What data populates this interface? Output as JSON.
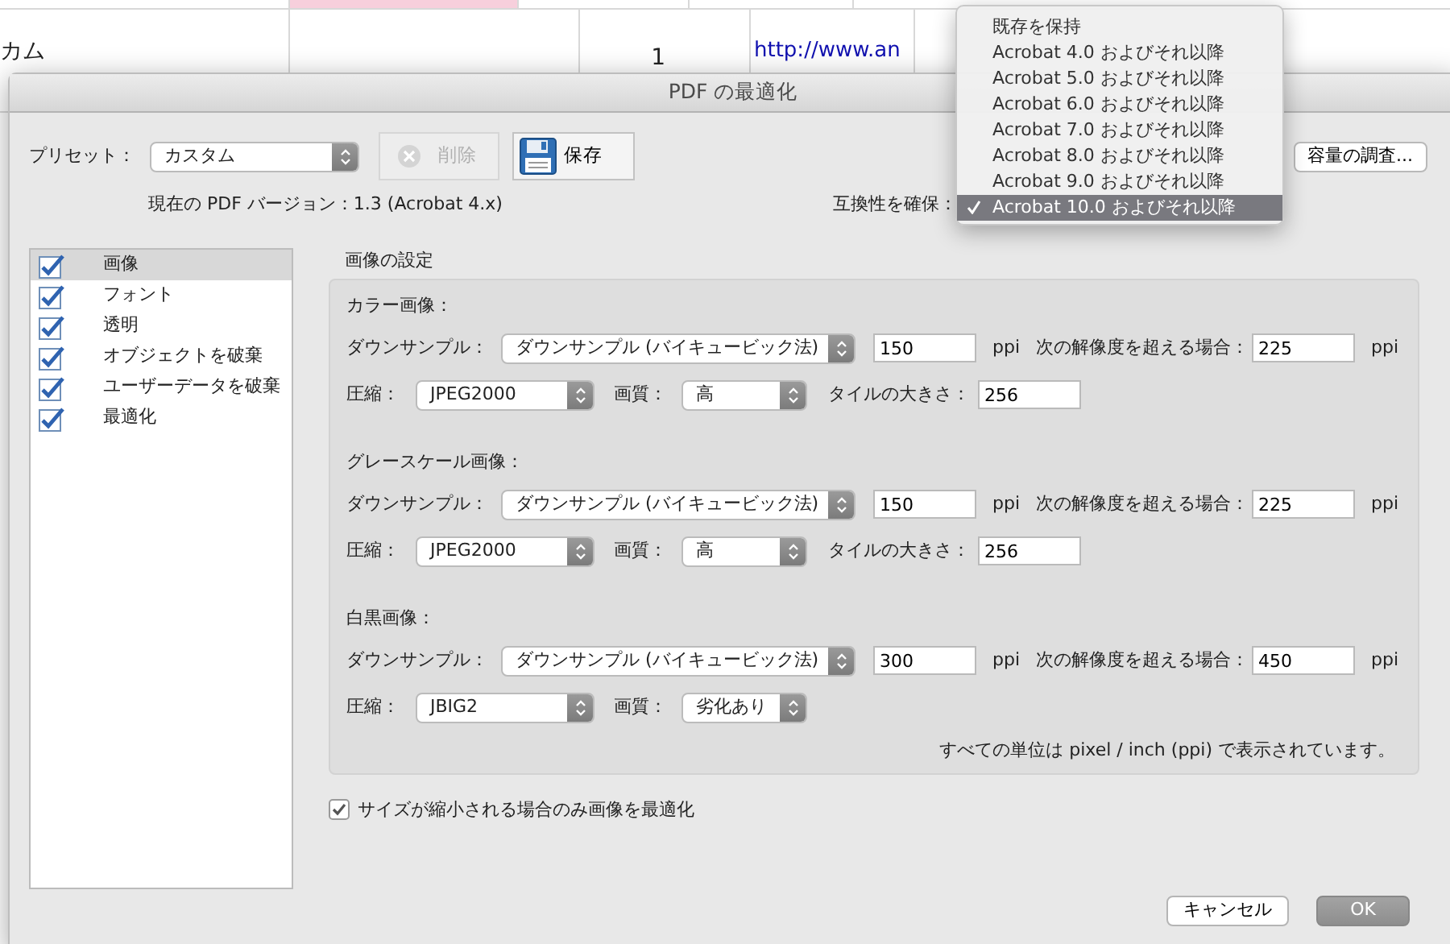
{
  "background_sheet": {
    "cells": [
      {
        "text": "カム",
        "kind": "text"
      },
      {
        "text": "1",
        "kind": "number"
      },
      {
        "text": "http://www.an",
        "kind": "link"
      }
    ]
  },
  "window": {
    "title": "PDF の最適化"
  },
  "preset": {
    "label": "プリセット：",
    "value": "カスタム"
  },
  "preset_buttons": [
    {
      "label": "削除",
      "kind": "delete",
      "disabled": true
    },
    {
      "label": "保存",
      "kind": "save",
      "disabled": false
    }
  ],
  "audit_button": "容量の調査...",
  "current_version": "現在の PDF バージョン：1.3 (Acrobat 4.x)",
  "compatibility": {
    "label": "互換性を確保：",
    "options": [
      {
        "label": "既存を保持",
        "selected": false
      },
      {
        "label": "Acrobat 4.0 およびそれ以降",
        "selected": false
      },
      {
        "label": "Acrobat 5.0 およびそれ以降",
        "selected": false
      },
      {
        "label": "Acrobat 6.0 およびそれ以降",
        "selected": false
      },
      {
        "label": "Acrobat 7.0 およびそれ以降",
        "selected": false
      },
      {
        "label": "Acrobat 8.0 およびそれ以降",
        "selected": false
      },
      {
        "label": "Acrobat 9.0 およびそれ以降",
        "selected": false
      },
      {
        "label": "Acrobat 10.0 およびそれ以降",
        "selected": true
      }
    ]
  },
  "sidebar": {
    "items": [
      {
        "label": "画像",
        "checked": true,
        "selected": true
      },
      {
        "label": "フォント",
        "checked": true,
        "selected": false
      },
      {
        "label": "透明",
        "checked": true,
        "selected": false
      },
      {
        "label": "オブジェクトを破棄",
        "checked": true,
        "selected": false
      },
      {
        "label": "ユーザーデータを破棄",
        "checked": true,
        "selected": false
      },
      {
        "label": "最適化",
        "checked": true,
        "selected": false
      }
    ]
  },
  "image_settings": {
    "title": "画像の設定",
    "sections": [
      {
        "title": "カラー画像：",
        "downsample_label": "ダウンサンプル：",
        "downsample": "ダウンサンプル (バイキュービック法)",
        "resolution": "150",
        "resolution_unit": "ppi",
        "threshold_label": "次の解像度を超える場合：",
        "threshold": "225",
        "threshold_unit": "ppi",
        "compression_label": "圧縮：",
        "compression": "JPEG2000",
        "quality_label": "画質：",
        "quality": "高",
        "tile_label": "タイルの大きさ：",
        "tile": "256"
      },
      {
        "title": "グレースケール画像：",
        "downsample_label": "ダウンサンプル：",
        "downsample": "ダウンサンプル (バイキュービック法)",
        "resolution": "150",
        "resolution_unit": "ppi",
        "threshold_label": "次の解像度を超える場合：",
        "threshold": "225",
        "threshold_unit": "ppi",
        "compression_label": "圧縮：",
        "compression": "JPEG2000",
        "quality_label": "画質：",
        "quality": "高",
        "tile_label": "タイルの大きさ：",
        "tile": "256"
      },
      {
        "title": "白黒画像：",
        "downsample_label": "ダウンサンプル：",
        "downsample": "ダウンサンプル (バイキュービック法)",
        "resolution": "300",
        "resolution_unit": "ppi",
        "threshold_label": "次の解像度を超える場合：",
        "threshold": "450",
        "threshold_unit": "ppi",
        "compression_label": "圧縮：",
        "compression": "JBIG2",
        "quality_label": "画質：",
        "quality": "劣化あり"
      }
    ],
    "note": "すべての単位は pixel / inch (ppi) で表示されています。"
  },
  "optimize_only_smaller": {
    "label": "サイズが縮小される場合のみ画像を最適化",
    "checked": true
  },
  "footer_buttons": [
    {
      "label": "キャンセル",
      "kind": "default"
    },
    {
      "label": "OK",
      "kind": "primary"
    }
  ]
}
